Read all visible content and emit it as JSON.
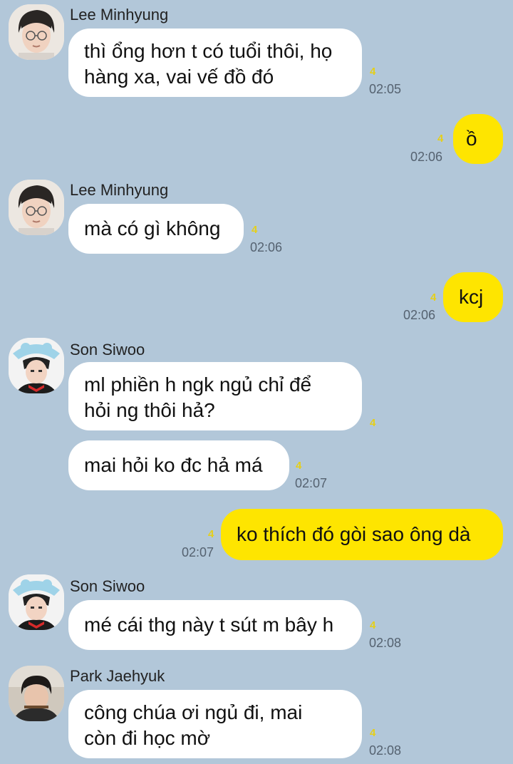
{
  "messages": [
    {
      "sender": "Lee Minhyung",
      "lines": [
        "thì ổng hơn t có tuổi thôi, họ",
        "hàng xa, vai vế đồ đó"
      ],
      "unread": "4",
      "time": "02:05"
    },
    {
      "mine": true,
      "lines": [
        "ồ"
      ],
      "unread": "4",
      "time": "02:06"
    },
    {
      "sender": "Lee Minhyung",
      "lines": [
        "mà có gì không"
      ],
      "unread": "4",
      "time": "02:06"
    },
    {
      "mine": true,
      "lines": [
        "kcj"
      ],
      "unread": "4",
      "time": "02:06"
    },
    {
      "sender": "Son Siwoo",
      "lines": [
        "ml phiền h ngk ngủ chỉ để",
        "hỏi ng thôi hả?"
      ],
      "unread": "4"
    },
    {
      "sender": "Son Siwoo",
      "lines": [
        "mai hỏi ko đc hả má"
      ],
      "unread": "4",
      "time": "02:07"
    },
    {
      "mine": true,
      "lines": [
        "ko thích đó gòi sao ông dà"
      ],
      "unread": "4",
      "time": "02:07"
    },
    {
      "sender": "Son Siwoo",
      "lines": [
        "mé cái thg này t sút m bây h"
      ],
      "unread": "4",
      "time": "02:08"
    },
    {
      "sender": "Park Jaehyuk",
      "lines": [
        "công chúa ơi ngủ đi, mai",
        "còn đi học mờ"
      ],
      "unread": "4",
      "time": "02:08"
    }
  ]
}
